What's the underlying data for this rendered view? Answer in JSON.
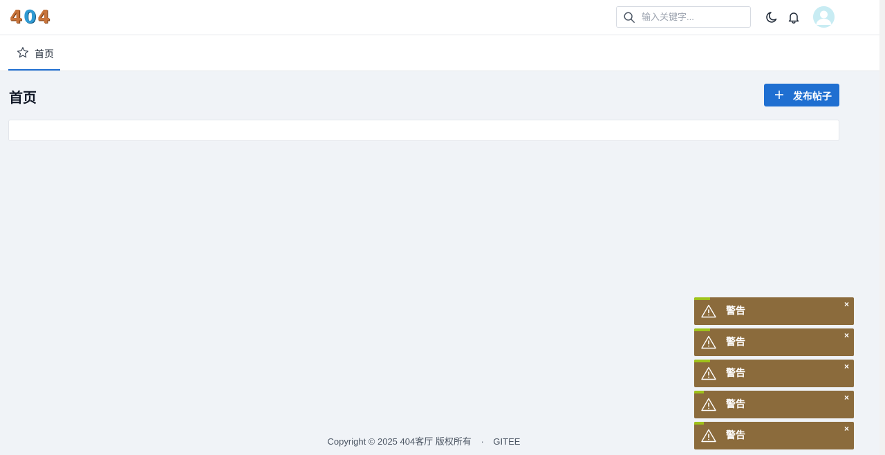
{
  "header": {
    "logo_text": [
      "4",
      "0",
      "4"
    ],
    "search": {
      "placeholder": "输入关键字..."
    },
    "icons": [
      "search-icon",
      "moon-icon",
      "bell-icon",
      "user-avatar-icon"
    ]
  },
  "tabs": [
    {
      "label": "首页",
      "icon": "star-icon",
      "active": true
    }
  ],
  "main": {
    "title": "首页",
    "publish_label": "发布帖子"
  },
  "footer": {
    "copyright": "Copyright © 2025 404客厅 版权所有",
    "separator": "·",
    "link_label": "GITEE"
  },
  "toasts": [
    {
      "title": "警告",
      "close": "×",
      "progress": 0.1
    },
    {
      "title": "警告",
      "close": "×",
      "progress": 0.1
    },
    {
      "title": "警告",
      "close": "×",
      "progress": 0.1
    },
    {
      "title": "警告",
      "close": "×",
      "progress": 0.06
    },
    {
      "title": "警告",
      "close": "×",
      "progress": 0.06
    }
  ],
  "colors": {
    "accent": "#1f6fd1",
    "toast_bg": "#8b6b3c",
    "toast_progress": "#9fc21a",
    "page_bg": "#f0f3f7"
  }
}
